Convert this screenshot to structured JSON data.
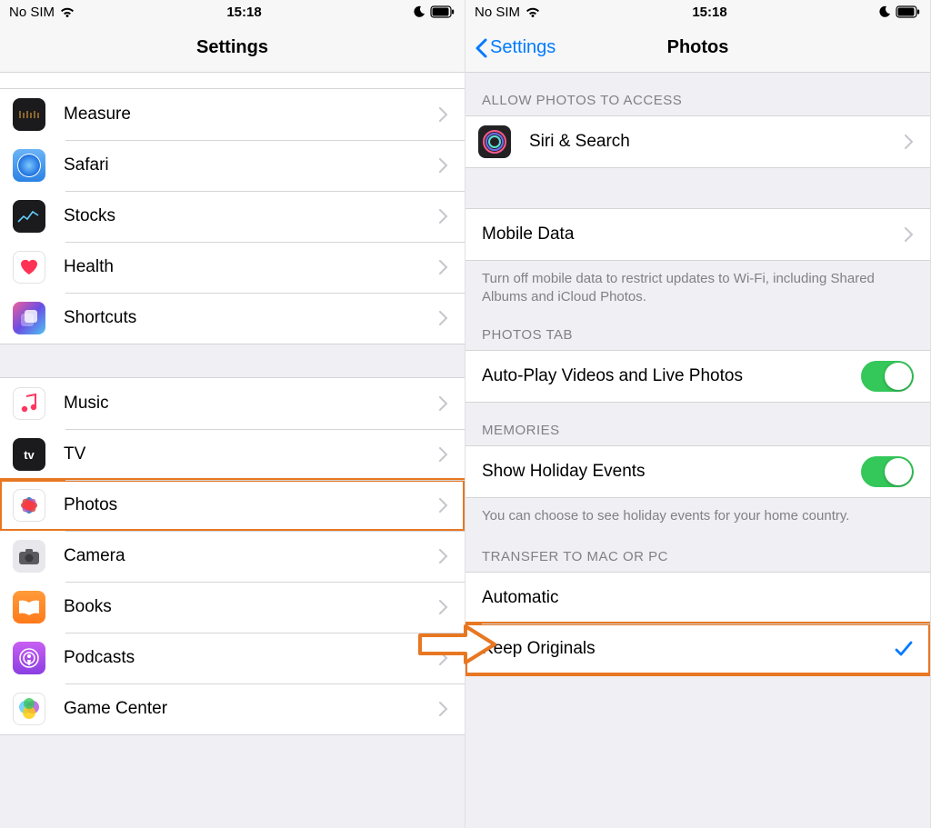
{
  "status": {
    "carrier": "No SIM",
    "time": "15:18"
  },
  "left": {
    "title": "Settings",
    "apps_group1": [
      {
        "id": "measure",
        "label": "Measure"
      },
      {
        "id": "safari",
        "label": "Safari"
      },
      {
        "id": "stocks",
        "label": "Stocks"
      },
      {
        "id": "health",
        "label": "Health"
      },
      {
        "id": "shortcuts",
        "label": "Shortcuts"
      }
    ],
    "apps_group2": [
      {
        "id": "music",
        "label": "Music"
      },
      {
        "id": "tv",
        "label": "TV"
      },
      {
        "id": "photos",
        "label": "Photos",
        "highlight": true
      },
      {
        "id": "camera",
        "label": "Camera"
      },
      {
        "id": "books",
        "label": "Books"
      },
      {
        "id": "podcasts",
        "label": "Podcasts"
      },
      {
        "id": "gamecenter",
        "label": "Game Center"
      }
    ]
  },
  "right": {
    "back": "Settings",
    "title": "Photos",
    "section_access_header": "ALLOW PHOTOS TO ACCESS",
    "siri_label": "Siri & Search",
    "mobile_data_label": "Mobile Data",
    "mobile_data_footer": "Turn off mobile data to restrict updates to Wi-Fi, including Shared Albums and iCloud Photos.",
    "photos_tab_header": "PHOTOS TAB",
    "autoplay_label": "Auto-Play Videos and Live Photos",
    "memories_header": "MEMORIES",
    "holiday_label": "Show Holiday Events",
    "holiday_footer": "You can choose to see holiday events for your home country.",
    "transfer_header": "TRANSFER TO MAC OR PC",
    "transfer_options": [
      {
        "label": "Automatic",
        "selected": false
      },
      {
        "label": "Keep Originals",
        "selected": true,
        "highlight": true
      }
    ]
  }
}
